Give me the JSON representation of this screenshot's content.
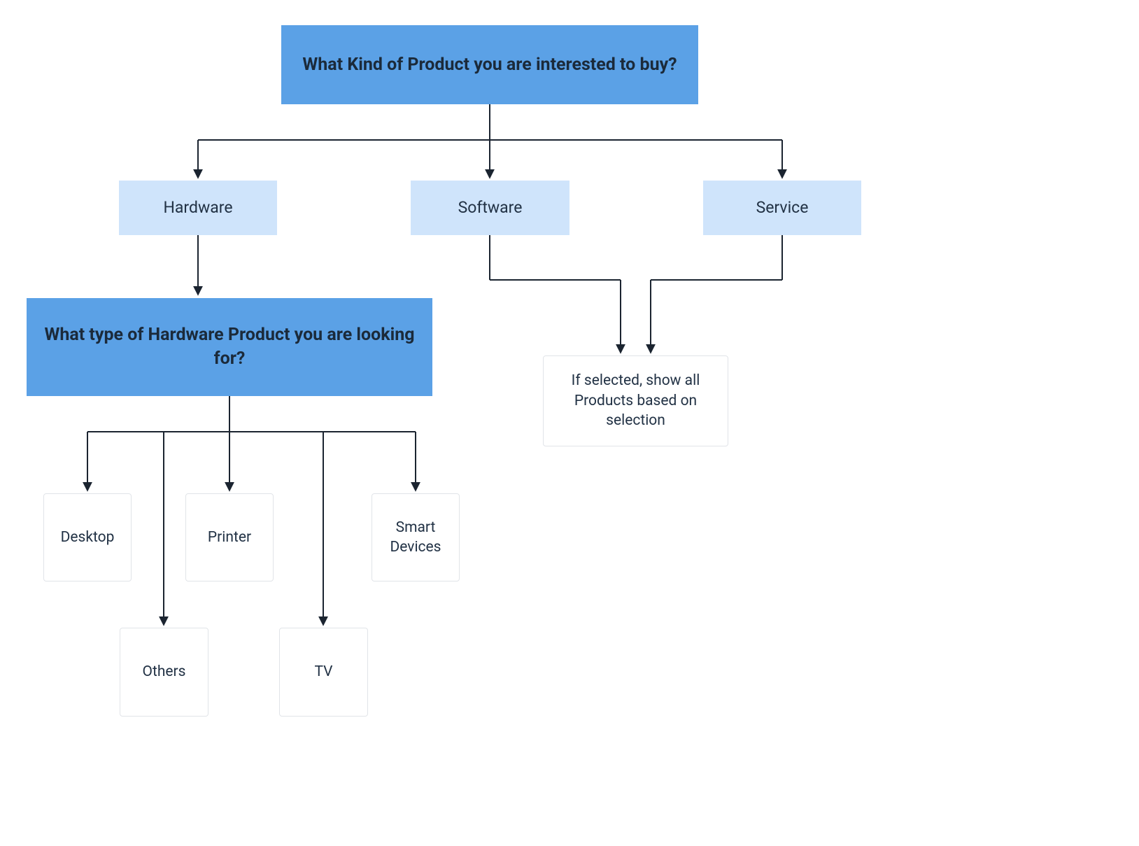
{
  "root": {
    "question": "What Kind of Product you are interested to buy?",
    "options": {
      "hardware": "Hardware",
      "software": "Software",
      "service": "Service"
    }
  },
  "hardware": {
    "question": "What type of Hardware Product you are looking for?",
    "options": {
      "desktop": "Desktop",
      "printer": "Printer",
      "smart_devices": "Smart Devices",
      "others": "Others",
      "tv": "TV"
    }
  },
  "result_note": "If selected, show all Products based on selection",
  "colors": {
    "primary": "#5ba1e6",
    "secondary": "#cfe4fb",
    "text": "#1d2b3a",
    "border": "#e1e4e8",
    "arrow": "#1b2430"
  }
}
